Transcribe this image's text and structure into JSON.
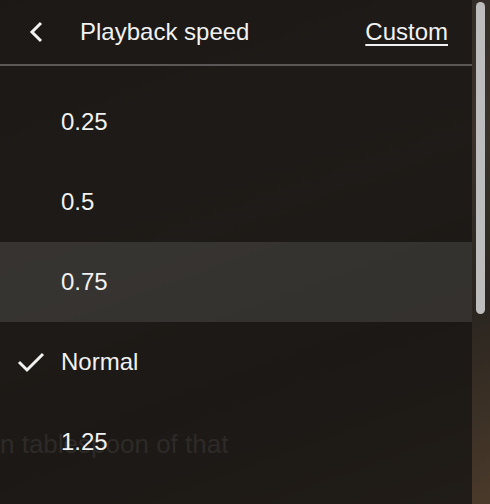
{
  "header": {
    "title": "Playback speed",
    "custom": "Custom"
  },
  "options": [
    {
      "label": "0.25",
      "selected": false,
      "highlighted": false
    },
    {
      "label": "0.5",
      "selected": false,
      "highlighted": false
    },
    {
      "label": "0.75",
      "selected": false,
      "highlighted": true
    },
    {
      "label": "Normal",
      "selected": true,
      "highlighted": false
    },
    {
      "label": "1.25",
      "selected": false,
      "highlighted": false
    }
  ],
  "caption": {
    "text": "n tablespoon of that"
  }
}
